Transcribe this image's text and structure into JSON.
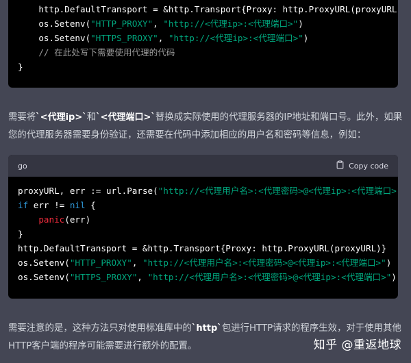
{
  "code_block_1": {
    "lines": [
      [
        {
          "t": "    http.DefaultTransport = &http.Transport{Proxy: http.ProxyURL(proxyURL)}"
        }
      ],
      [
        {
          "t": "    os.Setenv("
        },
        {
          "t": "\"HTTP_PROXY\"",
          "c": "s"
        },
        {
          "t": ", "
        },
        {
          "t": "\"http://<代理ip>:<代理端口>\"",
          "c": "s"
        },
        {
          "t": ")"
        }
      ],
      [
        {
          "t": "    os.Setenv("
        },
        {
          "t": "\"HTTPS_PROXY\"",
          "c": "s"
        },
        {
          "t": ", "
        },
        {
          "t": "\"http://<代理ip>:<代理端口>\"",
          "c": "s"
        },
        {
          "t": ")"
        }
      ],
      [
        {
          "t": "    // 在此处写下需要使用代理的代码",
          "c": "c"
        }
      ],
      [
        {
          "t": "}"
        }
      ]
    ]
  },
  "paragraph_1": {
    "before": "需要将",
    "code1": "`<代理ip>`",
    "mid": "和",
    "code2": "`<代理端口>`",
    "after": "替换成实际使用的代理服务器的IP地址和端口号。此外，如果您的代理服务器需要身份验证，还需要在代码中添加相应的用户名和密码等信息，例如："
  },
  "code_block_2": {
    "language": "go",
    "copy_label": "Copy code",
    "copy_icon": "clipboard-icon",
    "lines": [
      [
        {
          "t": "proxyURL, err := url.Parse("
        },
        {
          "t": "\"http://<代理用户名>:<代理密码>@<代理ip>:<代理端口>\"",
          "c": "s"
        },
        {
          "t": ")"
        }
      ],
      [
        {
          "t": "if",
          "c": "k"
        },
        {
          "t": " err != "
        },
        {
          "t": "nil",
          "c": "k"
        },
        {
          "t": " {"
        }
      ],
      [
        {
          "t": "    "
        },
        {
          "t": "panic",
          "c": "f"
        },
        {
          "t": "(err)"
        }
      ],
      [
        {
          "t": "}"
        }
      ],
      [
        {
          "t": "http.DefaultTransport = &http.Transport{Proxy: http.ProxyURL(proxyURL)}"
        }
      ],
      [
        {
          "t": "os.Setenv("
        },
        {
          "t": "\"HTTP_PROXY\"",
          "c": "s"
        },
        {
          "t": ", "
        },
        {
          "t": "\"http://<代理用户名>:<代理密码>@<代理ip>:<代理端口>\"",
          "c": "s"
        },
        {
          "t": ")"
        }
      ],
      [
        {
          "t": "os.Setenv("
        },
        {
          "t": "\"HTTPS_PROXY\"",
          "c": "s"
        },
        {
          "t": ", "
        },
        {
          "t": "\"http://<代理用户名>:<代理密码>@<代理ip>:<代理端口>\"",
          "c": "s"
        },
        {
          "t": ")"
        }
      ]
    ]
  },
  "paragraph_2": {
    "before": "需要注意的是，这种方法只对使用标准库中的",
    "code": "`http`",
    "after": "包进行HTTP请求的程序生效，对于使用其他HTTP客户端的程序可能需要进行额外的配置。"
  },
  "watermark": "知乎 @重返地球"
}
